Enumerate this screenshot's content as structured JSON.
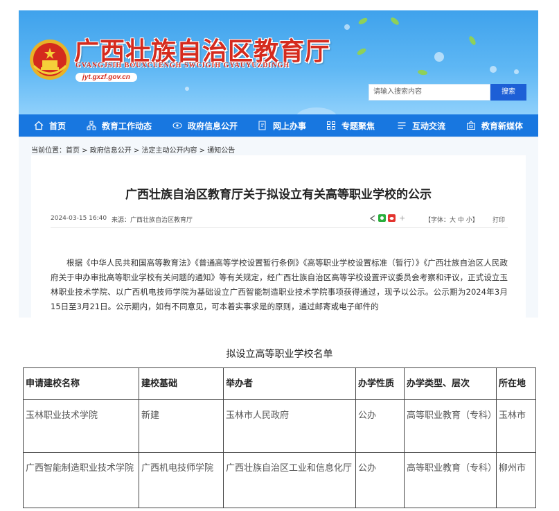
{
  "header": {
    "title": "广西壮族自治区教育厅",
    "subtitle": "GVANGJSIH BOUXCUENGH SWCIGIH GYAUYUZDINGH",
    "url": "jyt.gxzf.gov.cn",
    "search_placeholder": "请输入搜索内容",
    "search_button": "搜索"
  },
  "nav": {
    "items": [
      {
        "label": "首页",
        "icon": "home-icon"
      },
      {
        "label": "教育工作动态",
        "icon": "network-icon"
      },
      {
        "label": "政府信息公开",
        "icon": "eye-icon"
      },
      {
        "label": "网上办事",
        "icon": "edit-doc-icon"
      },
      {
        "label": "专题聚焦",
        "icon": "grid-icon"
      },
      {
        "label": "互动交流",
        "icon": "chat-icon"
      },
      {
        "label": "教育新媒体",
        "icon": "media-icon"
      }
    ]
  },
  "breadcrumb": "当前位置：首页 > 政府信息公开 > 法定主动公开内容 > 通知公告",
  "article": {
    "title": "广西壮族自治区教育厅关于拟设立有关高等职业学校的公示",
    "date": "2024-03-15 16:40",
    "source": "来源：广西壮族自治区教育厅",
    "font_size": "【字体：大 中 小】",
    "print": "打印",
    "body": "根据《中华人民共和国高等教育法》《普通高等学校设置暂行条例》《高等职业学校设置标准（暂行）》《广西壮族自治区人民政府关于申办审批高等职业学校有关问题的通知》等有关规定，经广西壮族自治区高等学校设置评议委员会考察和评议，正式设立玉林职业技术学院、以广西机电技师学院为基础设立广西智能制造职业技术学院事项获得通过，现予以公示。公示期为2024年3月15日至3月21日。公示期内，如有不同意见，可本着实事求是的原则，通过邮寄或电子邮件的"
  },
  "table": {
    "title": "拟设立高等职业学校名单",
    "headers": [
      "申请建校名称",
      "建校基础",
      "举办者",
      "办学性质",
      "办学类型、层次",
      "所在地"
    ],
    "rows": [
      [
        "玉林职业技术学院",
        "新建",
        "玉林市人民政府",
        "公办",
        "高等职业教育（专科）",
        "玉林市"
      ],
      [
        "广西智能制造职业技术学院",
        "广西机电技师学院",
        "广西壮族自治区工业和信息化厅",
        "公办",
        "高等职业教育（专科）",
        "柳州市"
      ]
    ]
  },
  "colors": {
    "nav_blue": "#1877e0",
    "title_red": "#d52b1e",
    "search_button": "#1d5fd6"
  }
}
